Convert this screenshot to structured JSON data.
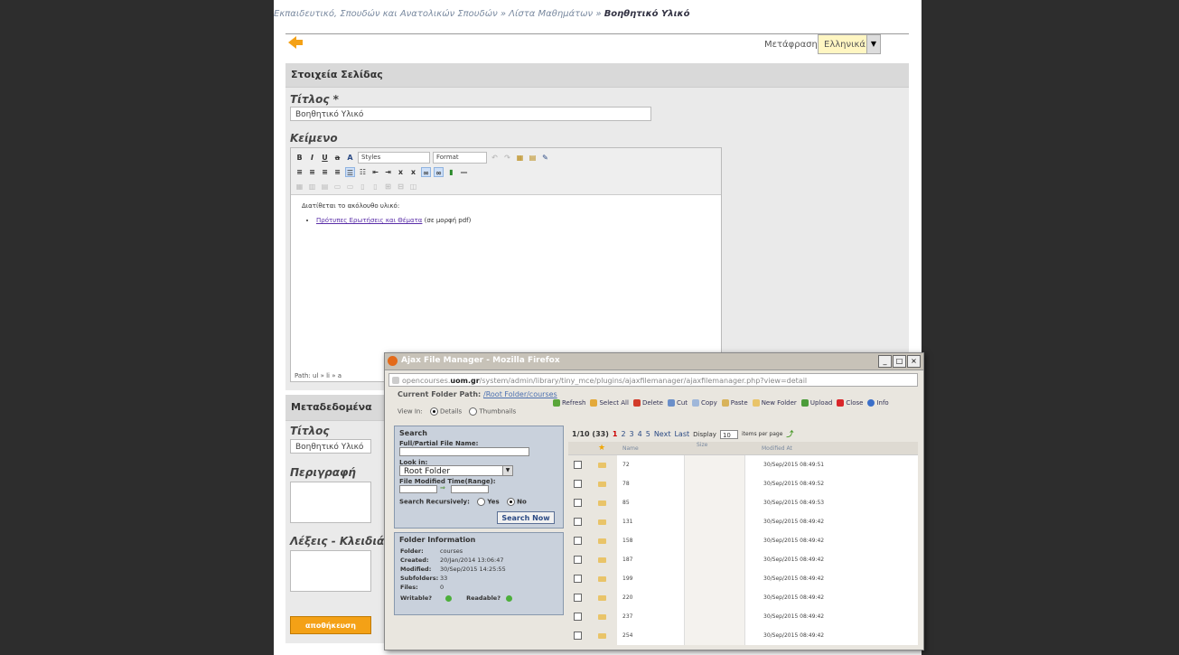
{
  "breadcrumb": {
    "parts": "Εκπαιδευτικό, Σπουδών και Ανατολικών Σπουδών  »  Λίστα Μαθημάτων  »",
    "current": "Βοηθητικό Υλικό"
  },
  "header": {
    "translation_label": "Μετάφραση:",
    "language": "Ελληνικά"
  },
  "page_details": {
    "section_title": "Στοιχεία Σελίδας",
    "title_label": "Τίτλος *",
    "title_value": "Βοηθητικό Υλικό",
    "text_label": "Κείμενο",
    "toolbar": {
      "styles": "Styles",
      "format": "Format"
    },
    "editor_text": "Διατίθεται το ακόλουθο υλικό:",
    "editor_link": "Πρότυπες Ερωτήσεις και Θέματα",
    "editor_link_suffix": "(σε μορφή pdf)",
    "editor_path": "Path: ul » li » a"
  },
  "metadata": {
    "section_title": "Μεταδεδομένα",
    "title_label": "Τίτλος",
    "title_value": "Βοηθητικό Υλικό",
    "description_label": "Περιγραφή",
    "keywords_label": "Λέξεις - Κλειδιά",
    "submit": "αποθήκευση"
  },
  "popup": {
    "title": "Ajax File Manager - Mozilla Firefox",
    "url_pre": "opencourses.",
    "url_domain": "uom.gr",
    "url_post": "/system/admin/library/tiny_mce/plugins/ajaxfilemanager/ajaxfilemanager.php?view=detail",
    "current_path_label": "Current Folder Path:",
    "current_path": "/Root Folder/courses",
    "view_in_label": "View In:",
    "view_details": "Details",
    "view_thumbnails": "Thumbnails",
    "actions": [
      "Refresh",
      "Select All",
      "Delete",
      "Cut",
      "Copy",
      "Paste",
      "New Folder",
      "Upload",
      "Close",
      "Info"
    ],
    "search": {
      "title": "Search",
      "name_label": "Full/Partial File Name:",
      "look_in_label": "Look in:",
      "look_in_value": "Root Folder",
      "modified_label": "File Modified Time(Range):",
      "recursive_label": "Search Recursively:",
      "yes": "Yes",
      "no": "No",
      "button": "Search Now"
    },
    "folder_info": {
      "title": "Folder Information",
      "folder_k": "Folder:",
      "folder_v": "courses",
      "created_k": "Created:",
      "created_v": "20/Jan/2014 13:06:47",
      "modified_k": "Modified:",
      "modified_v": "30/Sep/2015 14:25:55",
      "subfolders_k": "Subfolders:",
      "subfolders_v": "33",
      "files_k": "Files:",
      "files_v": "0",
      "writable_k": "Writable?",
      "readable_k": "Readable?"
    },
    "pager": {
      "summary": "1/10 (33)",
      "pages": [
        "1",
        "2",
        "3",
        "4",
        "5"
      ],
      "next": "Next",
      "last": "Last",
      "display": "Display",
      "per_page": "10",
      "items_per_page": "items per page"
    },
    "table": {
      "headers": {
        "name": "Name",
        "size": "Size",
        "modified": "Modified At"
      },
      "rows": [
        {
          "name": "72",
          "modified": "30/Sep/2015 08:49:51"
        },
        {
          "name": "78",
          "modified": "30/Sep/2015 08:49:52"
        },
        {
          "name": "85",
          "modified": "30/Sep/2015 08:49:53"
        },
        {
          "name": "131",
          "modified": "30/Sep/2015 08:49:42"
        },
        {
          "name": "158",
          "modified": "30/Sep/2015 08:49:42"
        },
        {
          "name": "187",
          "modified": "30/Sep/2015 08:49:42"
        },
        {
          "name": "199",
          "modified": "30/Sep/2015 08:49:42"
        },
        {
          "name": "220",
          "modified": "30/Sep/2015 08:49:42"
        },
        {
          "name": "237",
          "modified": "30/Sep/2015 08:49:42"
        },
        {
          "name": "254",
          "modified": "30/Sep/2015 08:49:42"
        }
      ]
    }
  },
  "colors": {
    "accent": "#f4a116",
    "panel": "#c9d1dc",
    "link": "#2b4a84"
  }
}
